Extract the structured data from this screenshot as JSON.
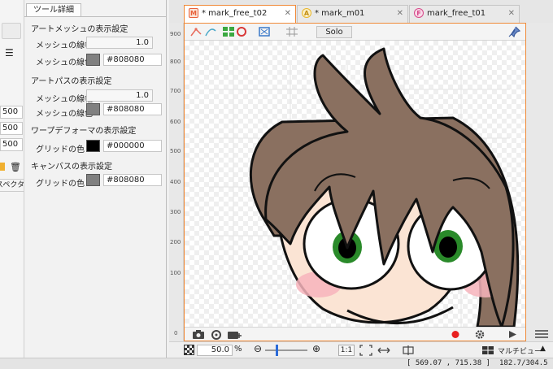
{
  "left_strip": {
    "numbers": [
      "500",
      "500",
      "500"
    ],
    "label": "スペクタ"
  },
  "tool_panel": {
    "tab_label": "ツール詳細",
    "sections": [
      {
        "title": "アートメッシュの表示設定",
        "rows": [
          {
            "label": "メッシュの線幅",
            "value": "1.0"
          },
          {
            "label": "メッシュの線色",
            "color": "#808080",
            "hex": "#808080"
          }
        ]
      },
      {
        "title": "アートパスの表示設定",
        "rows": [
          {
            "label": "メッシュの線幅",
            "value": "1.0"
          },
          {
            "label": "メッシュの線色",
            "color": "#808080",
            "hex": "#808080"
          }
        ]
      },
      {
        "title": "ワープデフォーマの表示設定",
        "rows": [
          {
            "label": "グリッドの色",
            "color": "#000000",
            "hex": "#000000"
          }
        ]
      },
      {
        "title": "キャンバスの表示設定",
        "rows": [
          {
            "label": "グリッドの色",
            "color": "#808080",
            "hex": "#808080"
          }
        ]
      }
    ]
  },
  "editor": {
    "tabs": [
      {
        "icon_letter": "M",
        "icon_color": "#e8603a",
        "label": "* mark_free_t02",
        "active": true
      },
      {
        "icon_letter": "A",
        "icon_color": "#e8b62a",
        "label": "* mark_m01",
        "active": false
      },
      {
        "icon_letter": "F",
        "icon_color": "#d64a8a",
        "label": "mark_free_t01",
        "active": false
      }
    ],
    "solo_label": "Solo",
    "ruler_ticks": [
      "900",
      "800",
      "700",
      "600",
      "500",
      "400",
      "300",
      "200",
      "100",
      "0"
    ],
    "zoom_value": "50.0",
    "zoom_unit": "%",
    "zoom_ratio_label": "1:1",
    "multiview_label": "マルチビュー",
    "accent_color": "#f08a38"
  },
  "status": {
    "coordinates": "[ 569.07 ,  715.38 ]",
    "scale_readout": "182.7/304.5"
  }
}
